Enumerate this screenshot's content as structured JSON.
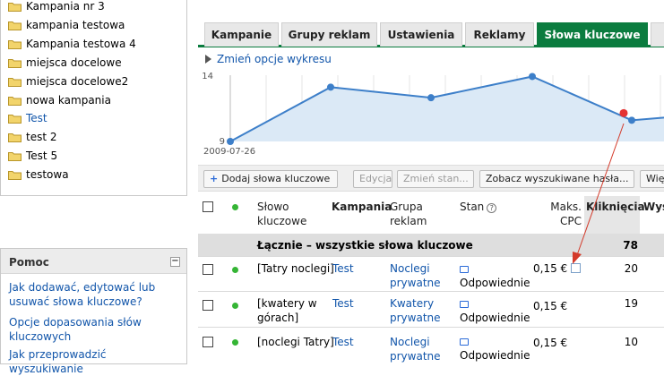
{
  "sidebar": {
    "campaigns": [
      {
        "label": "Kampania nr 3",
        "link": false
      },
      {
        "label": "kampania testowa",
        "link": false
      },
      {
        "label": "Kampania testowa 4",
        "link": false
      },
      {
        "label": "miejsca docelowe",
        "link": false
      },
      {
        "label": "miejsca docelowe2",
        "link": false
      },
      {
        "label": "nowa kampania",
        "link": false
      },
      {
        "label": "Test",
        "link": true
      },
      {
        "label": "test 2",
        "link": false
      },
      {
        "label": "Test 5",
        "link": false
      },
      {
        "label": "testowa",
        "link": false
      }
    ],
    "help": {
      "title": "Pomoc",
      "collapse": "−",
      "links": [
        "Jak dodawać, edytować lub usuwać słowa kluczowe?",
        "Opcje dopasowania słów kluczowych",
        "Jak przeprowadzić wyszukiwanie"
      ]
    }
  },
  "tabs": [
    {
      "label": "Kampanie",
      "active": false
    },
    {
      "label": "Grupy reklam",
      "active": false
    },
    {
      "label": "Ustawienia",
      "active": false
    },
    {
      "label": "Reklamy",
      "active": false
    },
    {
      "label": "Słowa kluczowe",
      "active": true
    },
    {
      "label": "",
      "active": false
    }
  ],
  "chart_toggle": "Zmień opcje wykresu",
  "chart_data": {
    "type": "area",
    "y_tick_labels": [
      "14",
      "9"
    ],
    "ylim": [
      9,
      14
    ],
    "x_start_label": "2009-07-26",
    "values": [
      9,
      13.1,
      12.3,
      13.9,
      10.6
    ],
    "highlight_index": 4,
    "colors": {
      "line": "#3d7fc9",
      "fill": "#dbe9f6",
      "highlight": "#e53333"
    }
  },
  "toolbar": {
    "add_keywords": "Dodaj słowa kluczowe",
    "edit": "Edycja",
    "change_status": "Zmień stan...",
    "see_search_terms": "Zobacz wyszukiwane hasła...",
    "more": "Więc"
  },
  "table": {
    "headers": {
      "keyword": "Słowo kluczowe",
      "campaign": "Kampania",
      "adgroup": "Grupa reklam",
      "status": "Stan",
      "max_cpc": "Maks. CPC",
      "clicks": "Kliknięcia",
      "impr": "Wyś"
    },
    "total": {
      "label": "Łącznie – wszystkie słowa kluczowe",
      "clicks": "78"
    },
    "rows": [
      {
        "keyword": "[Tatry noclegi]",
        "campaign": "Test",
        "adgroup": "Noclegi prywatne",
        "status": "Odpowiednie",
        "cpc": "0,15 €",
        "clicks": "20"
      },
      {
        "keyword": "[kwatery w górach]",
        "campaign": "Test",
        "adgroup": "Kwatery prywatne",
        "status": "Odpowiednie",
        "cpc": "0,15 €",
        "clicks": "19"
      },
      {
        "keyword": "[noclegi Tatry]",
        "campaign": "Test",
        "adgroup": "Noclegi prywatne",
        "status": "Odpowiednie",
        "cpc": "0,15 €",
        "clicks": "10"
      }
    ]
  }
}
